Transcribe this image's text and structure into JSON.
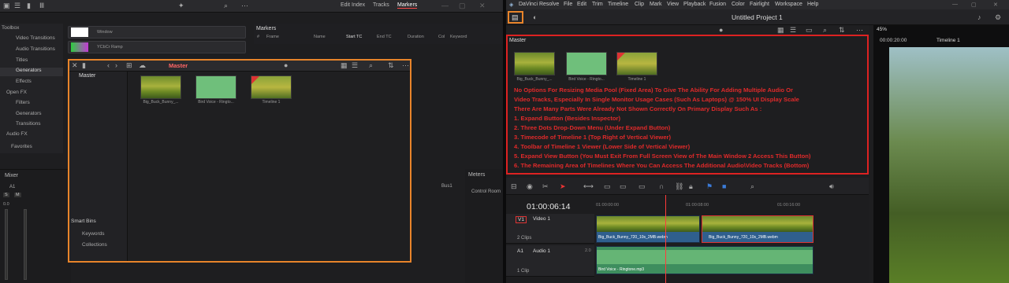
{
  "left": {
    "topbar": {
      "tabs": [
        "Edit Index",
        "Tracks",
        "Markers"
      ]
    },
    "toolbox": {
      "items": [
        "Toolbox",
        "Video Transitions",
        "Audio Transitions",
        "Titles",
        "Generators",
        "Effects",
        "Open FX",
        "Filters",
        "Generators",
        "Transitions",
        "Audio FX",
        "Favorites"
      ]
    },
    "generators": [
      "Window",
      "YCbCr Ramp"
    ],
    "markers": {
      "title": "Markers",
      "columns": [
        "#",
        "Frame",
        "Name",
        "Start TC",
        "End TC",
        "Duration",
        "Col",
        "Keyword"
      ]
    },
    "mixer": {
      "title": "Mixer",
      "track": "A1",
      "buttons": [
        "S",
        "M"
      ],
      "value": "0.0"
    },
    "meters": {
      "title": "Meters",
      "bus": "Bus1",
      "control_room": "Control Room"
    },
    "pool": {
      "title": "Master",
      "bin": "Master",
      "smart_bins": "Smart Bins",
      "smart_items": [
        "Keywords",
        "Collections"
      ],
      "clips": [
        "Big_Buck_Bunny_...",
        "Bird Voice - Ringto...",
        "Timeline 1"
      ]
    }
  },
  "right": {
    "menu": [
      "DaVinci Resolve",
      "File",
      "Edit",
      "Trim",
      "Timeline",
      "Clip",
      "Mark",
      "View",
      "Playback",
      "Fusion",
      "Color",
      "Fairlight",
      "Workspace",
      "Help"
    ],
    "project_title": "Untitled Project 1",
    "zoom": "45%",
    "timecode_top": "00:00:20:00",
    "timeline_name": "Timeline 1",
    "media_pool": {
      "title": "Master",
      "clips": [
        "Big_Buck_Bunny_...",
        "Bird Voice - Ringto...",
        "Timeline 1"
      ]
    },
    "note_lines": [
      "No Options For Resizing Media Pool (Fixed Area) To Give The Ability For Adding Multiple Audio Or",
      "Video Tracks, Especially In Single Monitor Usage Cases (Such As Laptops) @ 150% UI Display Scale",
      "There Are Many Parts Were Already Not Shown Correctly On Primary Display Such As :",
      "1. Expand Button (Besides Inspector)",
      "2. Three Dots Drop-Down Menu (Under Expand Button)",
      "3. Timecode of Timeline 1 (Top Right of Vertical Viewer)",
      "4. Toolbar of Timeline 1 Viewer (Lower Side of Vertical Viewer)",
      "5. Expand View Button (You Must Exit From Full Screen View of The Main Window 2 Access This Button)",
      "6. The Remaining Area of Timelines Where You Can Access The Additional Audio\\Video Tracks (Bottom)"
    ],
    "timeline": {
      "timecode": "01:00:06:14",
      "ruler": [
        "01:00:00:00",
        "01:00:08:00",
        "01:00:16:00"
      ],
      "v1": {
        "label": "V1",
        "name": "Video 1",
        "count": "2 Clips",
        "clips": [
          "Big_Buck_Bunny_720_10s_2MB.webm",
          "Big_Buck_Bunny_720_10s_2MB.webm"
        ]
      },
      "a1": {
        "label": "A1",
        "name": "Audio 1",
        "level": "2.0",
        "count": "1 Clip",
        "clip": "Bird Voice - Ringtone.mp3"
      }
    }
  },
  "colors": {
    "accent_orange": "#e8842a",
    "annotation_red": "#e02a2a",
    "marker_tab": "#ff6666"
  }
}
